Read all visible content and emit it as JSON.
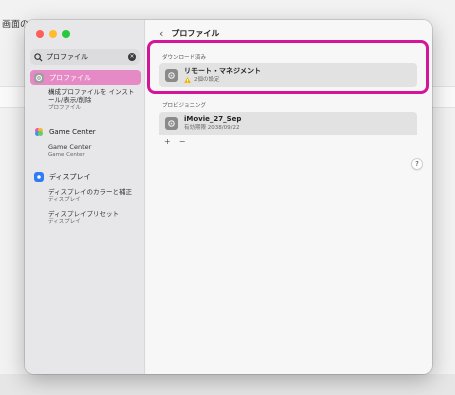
{
  "background": {
    "title": "画面の"
  },
  "sidebar": {
    "search": {
      "value": "プロファイル",
      "icon": "search-icon",
      "clear_icon": "clear-icon"
    },
    "items": [
      {
        "label": "プロファイル",
        "selected": true,
        "icon": "gear-icon",
        "color": "#9e9e9e"
      },
      {
        "label": "Game Center",
        "icon": "game-center-icon"
      },
      {
        "label": "ディスプレイ",
        "icon": "display-icon",
        "color": "#2f7cf6"
      }
    ],
    "subs": [
      {
        "text": "構成プロファイルを インストール/表示/削除",
        "category": "プロファイル"
      },
      {
        "text": "Game Center",
        "category": "Game Center"
      },
      {
        "text": "ディスプレイのカラーと補正",
        "category": "ディスプレイ"
      },
      {
        "text": "ディスプレイプリセット",
        "category": "ディスプレイ"
      }
    ]
  },
  "main": {
    "title": "プロファイル",
    "downloaded": {
      "label": "ダウンロード済み",
      "profile": {
        "title": "リモート・マネジメント",
        "sub": "2個の設定",
        "warning": true
      }
    },
    "provisioning": {
      "label": "プロビジョニング",
      "profile": {
        "title": "iMovie_27_Sep",
        "sub": "有効期限 2038/09/22"
      }
    },
    "add_label": "+",
    "remove_label": "−",
    "help_label": "?"
  },
  "colors": {
    "accent": "#e58ac5",
    "highlight": "#d4159a"
  }
}
